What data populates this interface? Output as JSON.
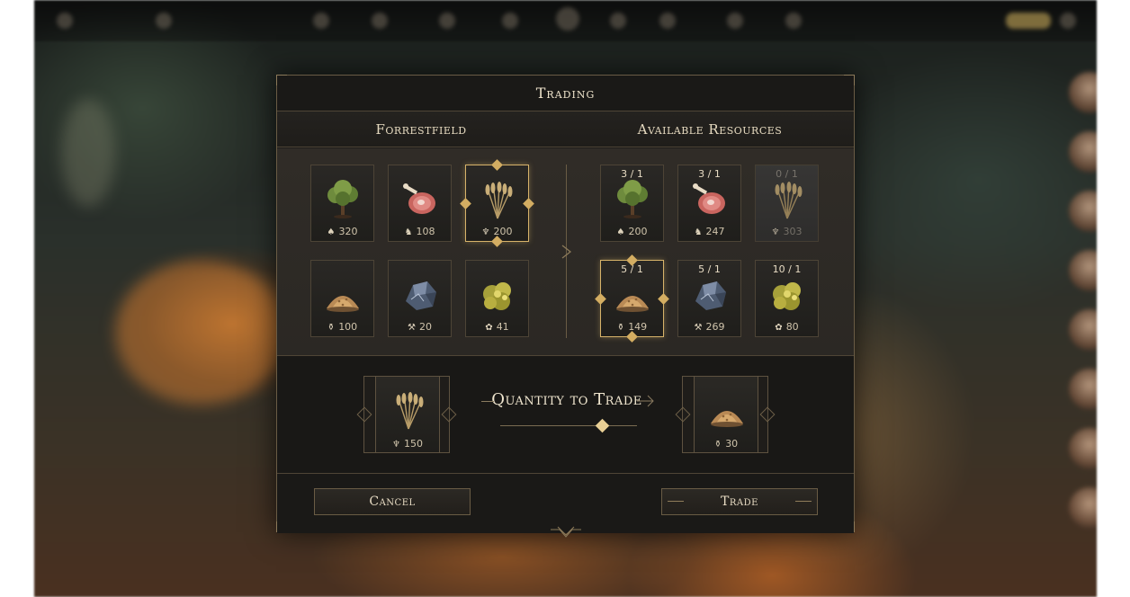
{
  "dialog": {
    "title": "Trading",
    "left_header": "Forrestfield",
    "right_header": "Available Resources"
  },
  "offer": [
    {
      "resource": "wood",
      "icon": "tree-icon",
      "symbol": "♠",
      "amount": "320",
      "selected": false
    },
    {
      "resource": "meat",
      "icon": "meat-icon",
      "symbol": "♞",
      "amount": "108",
      "selected": false
    },
    {
      "resource": "wheat",
      "icon": "wheat-icon",
      "symbol": "♆",
      "amount": "200",
      "selected": true
    },
    {
      "resource": "flour",
      "icon": "flour-pile-icon",
      "symbol": "⚱",
      "amount": "100",
      "selected": false
    },
    {
      "resource": "iron",
      "icon": "iron-ore-icon",
      "symbol": "⚒",
      "amount": "20",
      "selected": false
    },
    {
      "resource": "gold",
      "icon": "gold-ore-icon",
      "symbol": "✿",
      "amount": "41",
      "selected": false
    }
  ],
  "available": [
    {
      "resource": "wood",
      "icon": "tree-icon",
      "ratio": "3 / 1",
      "symbol": "♠",
      "amount": "200",
      "selected": false,
      "disabled": false
    },
    {
      "resource": "meat",
      "icon": "meat-icon",
      "ratio": "3 / 1",
      "symbol": "♞",
      "amount": "247",
      "selected": false,
      "disabled": false
    },
    {
      "resource": "wheat",
      "icon": "wheat-icon",
      "ratio": "0 / 1",
      "symbol": "♆",
      "amount": "303",
      "selected": false,
      "disabled": true
    },
    {
      "resource": "flour",
      "icon": "flour-pile-icon",
      "ratio": "5 / 1",
      "symbol": "⚱",
      "amount": "149",
      "selected": true,
      "disabled": false
    },
    {
      "resource": "iron",
      "icon": "iron-ore-icon",
      "ratio": "5 / 1",
      "symbol": "⚒",
      "amount": "269",
      "selected": false,
      "disabled": false
    },
    {
      "resource": "gold",
      "icon": "gold-ore-icon",
      "ratio": "10 / 1",
      "symbol": "✿",
      "amount": "80",
      "selected": false,
      "disabled": false
    }
  ],
  "trade": {
    "give": {
      "resource": "wheat",
      "icon": "wheat-icon",
      "symbol": "♆",
      "amount": "150"
    },
    "receive": {
      "resource": "flour",
      "icon": "flour-pile-icon",
      "symbol": "⚱",
      "amount": "30"
    },
    "quantity_label": "Quantity to Trade",
    "slider_fraction": 0.75
  },
  "buttons": {
    "cancel": "Cancel",
    "trade": "Trade"
  },
  "colors": {
    "accent": "#d7b36a",
    "panel": "#1c1b19",
    "border": "#6a5c45",
    "text": "#e8dcc4"
  }
}
